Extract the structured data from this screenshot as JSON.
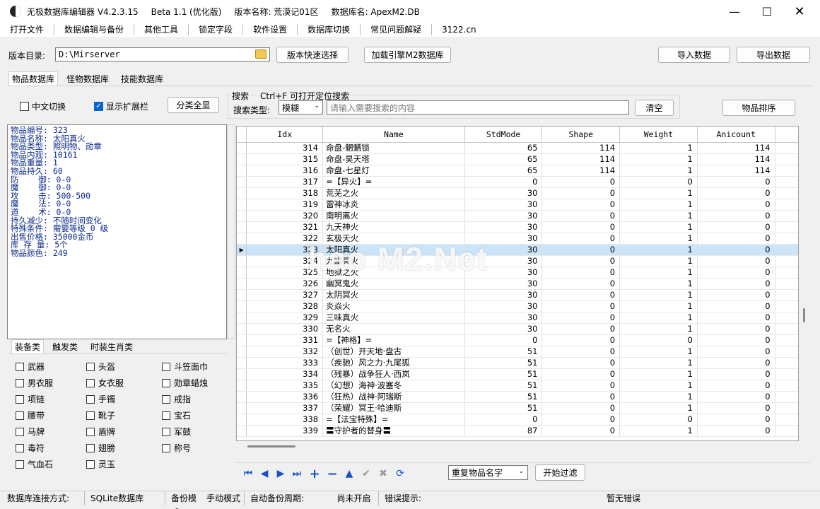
{
  "titlebar": {
    "app_name": "无极数据库编辑器 V4.2.3.15",
    "beta": "Beta 1.1 (优化版)",
    "version_name": "版本名称: 荒漠记01区",
    "db_name": "数据库名: ApexM2.DB"
  },
  "menu": [
    "打开文件",
    "数据编辑与备份",
    "其他工具",
    "锁定字段",
    "软件设置",
    "数据库切换",
    "常见问题解疑",
    "3122.cn"
  ],
  "toolbar": {
    "dir_label": "版本目录:",
    "dir_value": "D:\\Mirserver",
    "quick_select": "版本快速选择",
    "load_engine": "加载引擎M2数据库",
    "import": "导入数据",
    "export": "导出数据"
  },
  "tabs": [
    "物品数据库",
    "怪物数据库",
    "技能数据库"
  ],
  "options": {
    "chinese_switch": "中文切换",
    "show_ext": "显示扩展栏",
    "show_all": "分类全显",
    "search_title": "搜索",
    "search_hint": "Ctrl+F 可打开定位搜索",
    "search_type_label": "搜索类型:",
    "search_type_value": "模糊",
    "search_placeholder": "请输入需要搜索的内容",
    "clear": "清空",
    "sort": "物品排序"
  },
  "item_info": [
    "物品编号: 323",
    "物品名称: 太阳真火",
    "物品类型: 照明物、勋章",
    "物品内观: 10161",
    "物品重量: 1",
    "物品持久: 60",
    "防    御: 0-0",
    "魔    御: 0-0",
    "攻    击: 500-500",
    "魔    法: 0-0",
    "道    术: 0-0",
    "持久减少: 不随时间变化",
    "特殊条件: 需要等级 0 级",
    "出售价格: 35000金币",
    "库 存 量: 5个",
    "物品颜色: 249"
  ],
  "category_tabs": [
    "装备类",
    "触发类",
    "时装生肖类"
  ],
  "categories": [
    "武器",
    "头盔",
    "斗笠面巾",
    "男衣服",
    "女衣服",
    "勋章蜡烛",
    "项链",
    "手镯",
    "戒指",
    "腰带",
    "靴子",
    "宝石",
    "马牌",
    "盾牌",
    "军鼓",
    "毒符",
    "翅膀",
    "称号",
    "气血石",
    "灵玉"
  ],
  "table": {
    "columns": [
      "Idx",
      "Name",
      "StdMode",
      "Shape",
      "Weight",
      "Anicount"
    ],
    "selected_index": 9,
    "rows": [
      [
        "314",
        "命盘-魍魉锁",
        "65",
        "114",
        "1",
        "114"
      ],
      [
        "315",
        "命盘-昊天塔",
        "65",
        "114",
        "1",
        "114"
      ],
      [
        "316",
        "命盘-七星灯",
        "65",
        "114",
        "1",
        "114"
      ],
      [
        "317",
        "=【异火】=",
        "0",
        "0",
        "0",
        "0"
      ],
      [
        "318",
        "荒芜之火",
        "30",
        "0",
        "1",
        "0"
      ],
      [
        "319",
        "雷神冰炎",
        "30",
        "0",
        "1",
        "0"
      ],
      [
        "320",
        "南明离火",
        "30",
        "0",
        "1",
        "0"
      ],
      [
        "321",
        "九天神火",
        "30",
        "0",
        "1",
        "0"
      ],
      [
        "322",
        "玄极天火",
        "30",
        "0",
        "1",
        "0"
      ],
      [
        "323",
        "太阳真火",
        "30",
        "0",
        "1",
        "0"
      ],
      [
        "324",
        "九幽冥火",
        "30",
        "0",
        "1",
        "0"
      ],
      [
        "325",
        "地狱之火",
        "30",
        "0",
        "1",
        "0"
      ],
      [
        "326",
        "幽冥鬼火",
        "30",
        "0",
        "1",
        "0"
      ],
      [
        "327",
        "太阴冥火",
        "30",
        "0",
        "1",
        "0"
      ],
      [
        "328",
        "炎焱火",
        "30",
        "0",
        "1",
        "0"
      ],
      [
        "329",
        "三味真火",
        "30",
        "0",
        "1",
        "0"
      ],
      [
        "330",
        "无名火",
        "30",
        "0",
        "1",
        "0"
      ],
      [
        "331",
        "=【神格】=",
        "0",
        "0",
        "0",
        "0"
      ],
      [
        "332",
        "（创世）开天地·盘古",
        "51",
        "0",
        "1",
        "0"
      ],
      [
        "333",
        "（疾驰）风之力·九尾狐",
        "51",
        "0",
        "1",
        "0"
      ],
      [
        "334",
        "（残暴）战争狂人·西岚",
        "51",
        "0",
        "1",
        "0"
      ],
      [
        "335",
        "（幻想）海神·波塞冬",
        "51",
        "0",
        "1",
        "0"
      ],
      [
        "336",
        "（狂热）战神·阿瑞斯",
        "51",
        "0",
        "1",
        "0"
      ],
      [
        "337",
        "（荣耀）冥王·哈迪斯",
        "51",
        "0",
        "1",
        "0"
      ],
      [
        "338",
        "=【法宝特殊】=",
        "0",
        "0",
        "0",
        "0"
      ],
      [
        "339",
        "〓守护者的替身〓",
        "87",
        "0",
        "1",
        "0"
      ]
    ]
  },
  "bottom": {
    "dup_select": "重复物品名字",
    "start_filter": "开始过滤"
  },
  "status": {
    "conn_label": "数据库连接方式:",
    "conn_value": "SQLite数据库",
    "backup_label": "备份模式:",
    "backup_value": "手动模式",
    "auto_label": "自动备份周期:",
    "auto_value": "尚未开启",
    "err_label": "错误提示:",
    "err_value": "暂无错误"
  },
  "watermark": "hao M2.Net",
  "colors": {
    "selection": "#cce4f7",
    "info_text": "#0c2a8a",
    "nav_blue": "#1454c8"
  }
}
